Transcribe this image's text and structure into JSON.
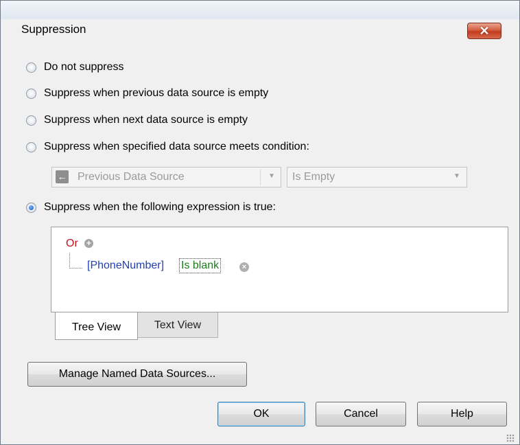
{
  "window": {
    "title": "Suppression",
    "close_glyph": "✕"
  },
  "options": [
    {
      "label": "Do not suppress",
      "checked": false
    },
    {
      "label": "Suppress when previous data source is empty",
      "checked": false
    },
    {
      "label": "Suppress when next data source is empty",
      "checked": false
    },
    {
      "label": "Suppress when specified data source meets condition:",
      "checked": false
    },
    {
      "label": "Suppress when the following expression is true:",
      "checked": true
    }
  ],
  "condition": {
    "source_value": "Previous Data Source",
    "source_icon": "left-arrow-icon",
    "operator_value": "Is Empty"
  },
  "expression": {
    "operator": "Or",
    "field": "[PhoneNumber]",
    "condition": "Is blank"
  },
  "tabs": [
    {
      "label": "Tree View",
      "active": true
    },
    {
      "label": "Text View",
      "active": false
    }
  ],
  "buttons": {
    "manage": "Manage Named Data Sources...",
    "ok": "OK",
    "cancel": "Cancel",
    "help": "Help"
  },
  "colors": {
    "operator": "#c1121f",
    "field": "#1f3fb4",
    "condition": "#1c7a1c",
    "close_button": "#c23b1f"
  }
}
